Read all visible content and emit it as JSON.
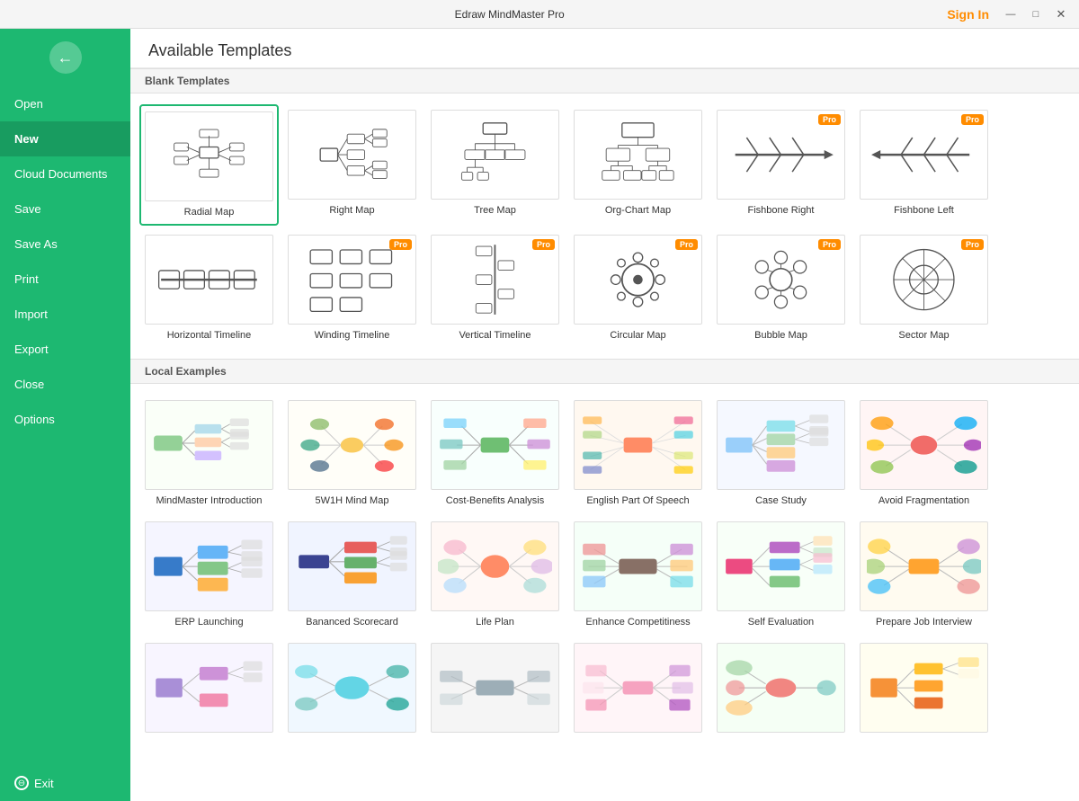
{
  "titlebar": {
    "title": "Edraw MindMaster Pro",
    "controls": [
      "—",
      "□",
      "✕"
    ],
    "sign_in": "Sign In"
  },
  "sidebar": {
    "back_icon": "←",
    "items": [
      {
        "id": "open",
        "label": "Open"
      },
      {
        "id": "new",
        "label": "New"
      },
      {
        "id": "cloud",
        "label": "Cloud Documents"
      },
      {
        "id": "save",
        "label": "Save"
      },
      {
        "id": "saveas",
        "label": "Save As"
      },
      {
        "id": "print",
        "label": "Print"
      },
      {
        "id": "import",
        "label": "Import"
      },
      {
        "id": "export",
        "label": "Export"
      },
      {
        "id": "close",
        "label": "Close"
      },
      {
        "id": "options",
        "label": "Options"
      }
    ],
    "exit_label": "Exit"
  },
  "main": {
    "page_title": "Available Templates",
    "sections": [
      {
        "id": "blank",
        "header": "Blank Templates",
        "templates": [
          {
            "id": "radial",
            "label": "Radial Map",
            "pro": false,
            "selected": true,
            "type": "blank"
          },
          {
            "id": "right",
            "label": "Right Map",
            "pro": false,
            "selected": false,
            "type": "blank"
          },
          {
            "id": "tree",
            "label": "Tree Map",
            "pro": false,
            "selected": false,
            "type": "blank"
          },
          {
            "id": "orgchart",
            "label": "Org-Chart Map",
            "pro": false,
            "selected": false,
            "type": "blank"
          },
          {
            "id": "fishbone_right",
            "label": "Fishbone Right",
            "pro": true,
            "selected": false,
            "type": "blank"
          },
          {
            "id": "fishbone_left",
            "label": "Fishbone Left",
            "pro": true,
            "selected": false,
            "type": "blank"
          },
          {
            "id": "h_timeline",
            "label": "Horizontal Timeline",
            "pro": false,
            "selected": false,
            "type": "blank"
          },
          {
            "id": "w_timeline",
            "label": "Winding Timeline",
            "pro": true,
            "selected": false,
            "type": "blank"
          },
          {
            "id": "v_timeline",
            "label": "Vertical Timeline",
            "pro": true,
            "selected": false,
            "type": "blank"
          },
          {
            "id": "circular",
            "label": "Circular Map",
            "pro": true,
            "selected": false,
            "type": "blank"
          },
          {
            "id": "bubble",
            "label": "Bubble Map",
            "pro": true,
            "selected": false,
            "type": "blank"
          },
          {
            "id": "sector",
            "label": "Sector Map",
            "pro": true,
            "selected": false,
            "type": "blank"
          }
        ]
      },
      {
        "id": "local",
        "header": "Local Examples",
        "templates": [
          {
            "id": "mindmaster_intro",
            "label": "MindMaster Introduction",
            "pro": false,
            "selected": false,
            "type": "local"
          },
          {
            "id": "5w1h",
            "label": "5W1H Mind Map",
            "pro": false,
            "selected": false,
            "type": "local"
          },
          {
            "id": "cost_benefits",
            "label": "Cost-Benefits Analysis",
            "pro": false,
            "selected": false,
            "type": "local"
          },
          {
            "id": "english_speech",
            "label": "English Part Of Speech",
            "pro": false,
            "selected": false,
            "type": "local"
          },
          {
            "id": "case_study",
            "label": "Case Study",
            "pro": false,
            "selected": false,
            "type": "local"
          },
          {
            "id": "avoid_frag",
            "label": "Avoid Fragmentation",
            "pro": false,
            "selected": false,
            "type": "local"
          },
          {
            "id": "erp",
            "label": "ERP Launching",
            "pro": false,
            "selected": false,
            "type": "local"
          },
          {
            "id": "balanced",
            "label": "Bananced Scorecard",
            "pro": false,
            "selected": false,
            "type": "local"
          },
          {
            "id": "life_plan",
            "label": "Life Plan",
            "pro": false,
            "selected": false,
            "type": "local"
          },
          {
            "id": "enhance",
            "label": "Enhance Competitiness",
            "pro": false,
            "selected": false,
            "type": "local"
          },
          {
            "id": "self_eval",
            "label": "Self Evaluation",
            "pro": false,
            "selected": false,
            "type": "local"
          },
          {
            "id": "job_interview",
            "label": "Prepare Job Interview",
            "pro": false,
            "selected": false,
            "type": "local"
          },
          {
            "id": "row3_1",
            "label": "",
            "pro": false,
            "selected": false,
            "type": "local"
          },
          {
            "id": "row3_2",
            "label": "",
            "pro": false,
            "selected": false,
            "type": "local"
          },
          {
            "id": "row3_3",
            "label": "",
            "pro": false,
            "selected": false,
            "type": "local"
          },
          {
            "id": "row3_4",
            "label": "",
            "pro": false,
            "selected": false,
            "type": "local"
          },
          {
            "id": "row3_5",
            "label": "",
            "pro": false,
            "selected": false,
            "type": "local"
          },
          {
            "id": "row3_6",
            "label": "",
            "pro": false,
            "selected": false,
            "type": "local"
          }
        ]
      }
    ]
  }
}
